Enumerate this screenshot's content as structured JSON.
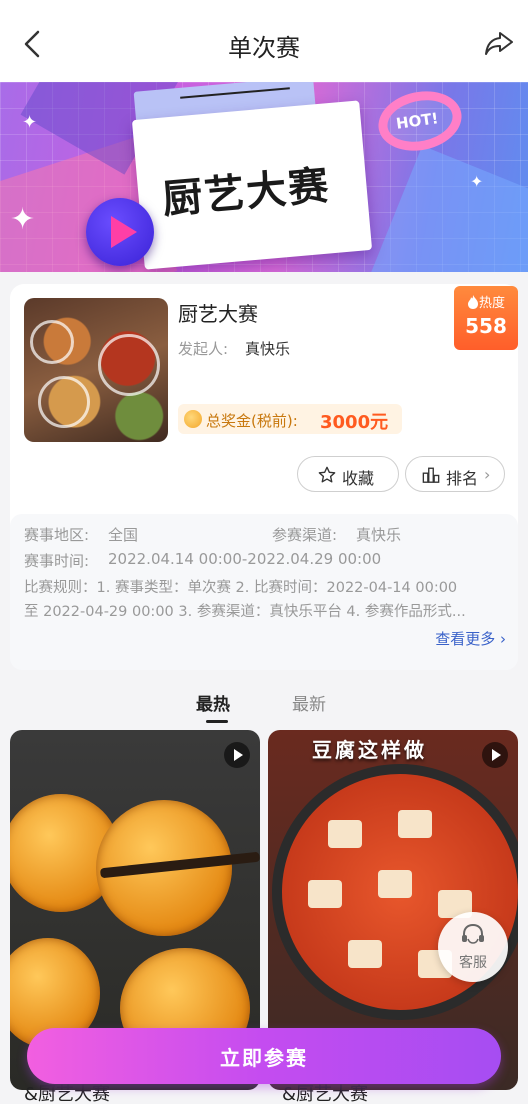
{
  "header": {
    "title": "单次赛"
  },
  "banner": {
    "title": "厨艺大赛",
    "badge": "HOT!"
  },
  "contest": {
    "name": "厨艺大赛",
    "organizer_label": "发起人:",
    "organizer": "真快乐",
    "heat_label": "热度",
    "heat_value": "558",
    "prize_label": "总奖金(税前):",
    "prize_value": "3000元",
    "favorite_label": "收藏",
    "rank_label": "排名"
  },
  "details": {
    "region_label": "赛事地区:",
    "region": "全国",
    "channel_label": "参赛渠道:",
    "channel": "真快乐",
    "time_label": "赛事时间:",
    "time": "2022.04.14 00:00-2022.04.29 00:00",
    "rules_line1": "比赛规则：1. 赛事类型：单次赛 2. 比赛时间：2022-04-14 00:00",
    "rules_line2": "至 2022-04-29 00:00 3. 参赛渠道：真快乐平台 4. 参赛作品形式...",
    "more": "查看更多"
  },
  "tabs": [
    {
      "label": "最热"
    },
    {
      "label": "最新"
    }
  ],
  "feed": [
    {
      "caption": "&厨艺大赛",
      "overlay": ""
    },
    {
      "caption": "&厨艺大赛",
      "overlay": "豆腐这样做"
    }
  ],
  "service": {
    "label": "客服"
  },
  "join": {
    "label": "立即参赛"
  },
  "colors": {
    "accent": "#c44cf0",
    "heat": "#ff5e2a",
    "prize": "#ff5a1f",
    "link": "#3a62c9"
  }
}
